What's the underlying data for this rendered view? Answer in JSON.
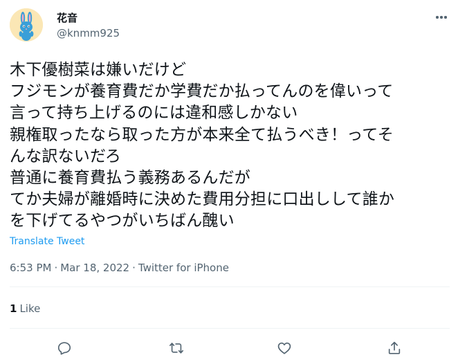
{
  "author": {
    "display_name": "花音",
    "handle": "@knmm925",
    "avatar_icon": "rabbit-avatar-icon"
  },
  "tweet": {
    "lines": [
      "木下優樹菜は嫌いだけど",
      "フジモンが養育費だか学費だか払ってんのを偉いって",
      "言って持ち上げるのには違和感しかない",
      "親権取ったなら取った方が本来全て払うべき！ってそ",
      "んな訳ないだろ",
      "普通に養育費払う義務あるんだが",
      "てか夫婦が離婚時に決めた費用分担に口出しして誰か",
      "を下げてるやつがいちばん醜い"
    ],
    "translate_label": "Translate Tweet",
    "time": "6:53 PM",
    "separator": "·",
    "date": "Mar 18, 2022",
    "source": "Twitter for iPhone"
  },
  "stats": {
    "likes_count": "1",
    "likes_label": "Like"
  },
  "actions": [
    "reply-icon",
    "retweet-icon",
    "like-icon",
    "share-icon"
  ],
  "colors": {
    "text": "#0f1419",
    "secondary": "#536471",
    "link": "#1d9bf0",
    "divider": "#eff3f4",
    "avatar_bg": "#fbe7b5",
    "rabbit": "#3a9fd8"
  }
}
